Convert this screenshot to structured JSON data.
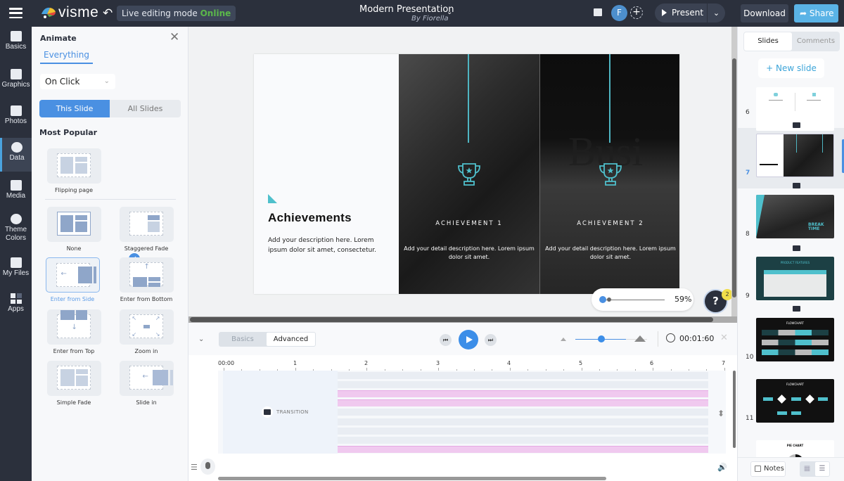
{
  "topbar": {
    "logo_text": "visme",
    "live_mode_label": "Live editing mode",
    "live_mode_status": "Online",
    "doc_title": "Modern Presentation",
    "doc_author": "By Fiorella",
    "avatar_initial": "F",
    "present_label": "Present",
    "download_label": "Download",
    "share_label": "Share",
    "colors": {
      "bar": "#2b303c",
      "share": "#5ab3e6",
      "online": "#5bb84a"
    }
  },
  "leftnav": {
    "items": [
      {
        "label": "Basics",
        "icon": "abc-blocks-icon"
      },
      {
        "label": "Graphics",
        "icon": "graphics-icon"
      },
      {
        "label": "Photos",
        "icon": "photo-icon"
      },
      {
        "label": "Data",
        "icon": "pie-chart-icon",
        "active": true
      },
      {
        "label": "Media",
        "icon": "media-play-icon"
      },
      {
        "label": "Theme",
        "label2": "Colors",
        "icon": "palette-icon"
      },
      {
        "label": "My Files",
        "icon": "folder-icon"
      },
      {
        "label": "Apps",
        "icon": "apps-grid-icon"
      }
    ]
  },
  "animate_panel": {
    "title": "Animate",
    "tab": "Everything",
    "trigger_select": "On Click",
    "scope_options": [
      "This Slide",
      "All Slides"
    ],
    "scope_selected": "This Slide",
    "section_title": "Most Popular",
    "popular": [
      "Flipping page"
    ],
    "animations": [
      "None",
      "Staggered Fade",
      "Enter from Side",
      "Enter from Bottom",
      "Enter from Top",
      "Zoom in",
      "Simple Fade",
      "Slide in"
    ],
    "selected_animation": "Enter from Side"
  },
  "slide": {
    "title": "Achievements",
    "description": "Add your description here. Lorem ipsum dolor sit amet, consectetur.",
    "achievements": [
      {
        "title": "ACHIEVEMENT 1",
        "description": "Add your detail description here. Lorem ipsum dolor sit amet."
      },
      {
        "title": "ACHIEVEMENT 2",
        "description": "Add your detail description here. Lorem ipsum dolor sit amet."
      }
    ],
    "background_text": "Busi",
    "accent_color": "#4fc0cc"
  },
  "canvas": {
    "zoom_value": "59%",
    "zoom_fraction": 0.05,
    "help_label": "?",
    "help_badge": "2"
  },
  "timeline": {
    "modes": [
      "Basics",
      "Advanced"
    ],
    "mode_selected": "Advanced",
    "duration": "00:01:60",
    "ruler_labels": [
      "00:00",
      "1",
      "2",
      "3",
      "4",
      "5",
      "6",
      "7"
    ],
    "track_label": "TRANSITION",
    "speed_fraction": 0.38,
    "rows": [
      "gray",
      "gray",
      "pink",
      "pink",
      "gray",
      "gray",
      "gray",
      "gray",
      "pink"
    ]
  },
  "right_panel": {
    "tabs": [
      "Slides",
      "Comments"
    ],
    "tab_selected": "Slides",
    "new_slide_label": "+ New slide",
    "slides": [
      {
        "number": "6"
      },
      {
        "number": "7",
        "current": true
      },
      {
        "number": "8",
        "thumb_text": "BREAK TIME"
      },
      {
        "number": "9",
        "thumb_text": "PRODUCT FEATURES"
      },
      {
        "number": "10",
        "thumb_text": "FLOWCHART"
      },
      {
        "number": "11",
        "thumb_text": "FLOWCHART"
      },
      {
        "number": "",
        "thumb_text": "PIE CHART"
      }
    ],
    "notes_label": "Notes"
  }
}
